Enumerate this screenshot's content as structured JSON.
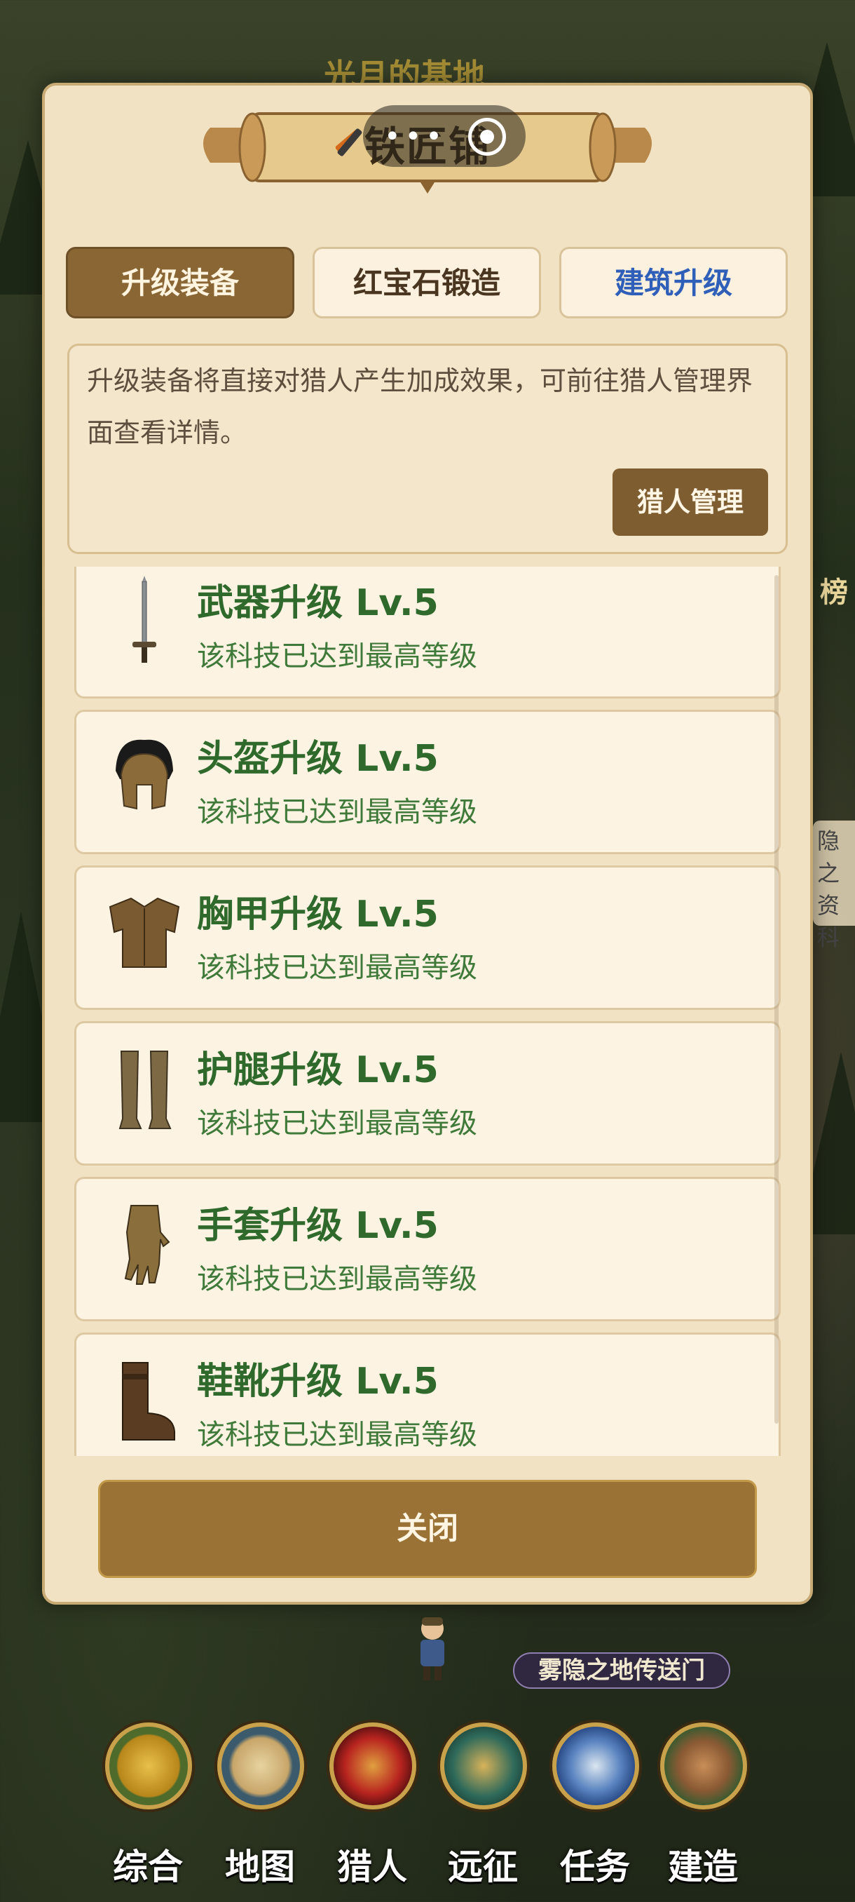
{
  "background": {
    "title_faded": "光月的基地",
    "portal_label": "雾隐之地传送门",
    "side_text": [
      "隐之",
      "资科"
    ],
    "side_rank": "榜"
  },
  "dialog": {
    "title": "铁匠铺",
    "tabs": [
      {
        "label": "升级装备",
        "state": "active"
      },
      {
        "label": "红宝石锻造",
        "state": "normal"
      },
      {
        "label": "建筑升级",
        "state": "highlight",
        "color": "#2f5fb8"
      }
    ],
    "info_text": "升级装备将直接对猎人产生加成效果，可前往猎人管理界面查看详情。",
    "manage_button": "猎人管理",
    "items": [
      {
        "title": "武器升级 Lv.5",
        "desc": "该科技已达到最高等级",
        "icon": "sword-icon"
      },
      {
        "title": "头盔升级 Lv.5",
        "desc": "该科技已达到最高等级",
        "icon": "helmet-icon"
      },
      {
        "title": "胸甲升级 Lv.5",
        "desc": "该科技已达到最高等级",
        "icon": "chestplate-icon"
      },
      {
        "title": "护腿升级 Lv.5",
        "desc": "该科技已达到最高等级",
        "icon": "greaves-icon"
      },
      {
        "title": "手套升级 Lv.5",
        "desc": "该科技已达到最高等级",
        "icon": "gauntlet-icon"
      },
      {
        "title": "鞋靴升级 Lv.5",
        "desc": "该科技已达到最高等级",
        "icon": "boot-icon"
      }
    ],
    "close_button": "关闭"
  },
  "nav": [
    {
      "label": "综合",
      "icon": "coin-icon",
      "color": "#4e6b2c"
    },
    {
      "label": "地图",
      "icon": "map-icon",
      "color": "#3b5a6c"
    },
    {
      "label": "猎人",
      "icon": "bow-icon",
      "color": "#8b1f1f"
    },
    {
      "label": "远征",
      "icon": "compass-icon",
      "color": "#2f6a5a"
    },
    {
      "label": "任务",
      "icon": "scroll-icon",
      "color": "#2c4e8a"
    },
    {
      "label": "建造",
      "icon": "castle-icon",
      "color": "#3f5a30"
    }
  ],
  "colors": {
    "panel": "#f1e2c4",
    "accent_brown": "#8a6635",
    "item_green": "#2f6a2c"
  }
}
